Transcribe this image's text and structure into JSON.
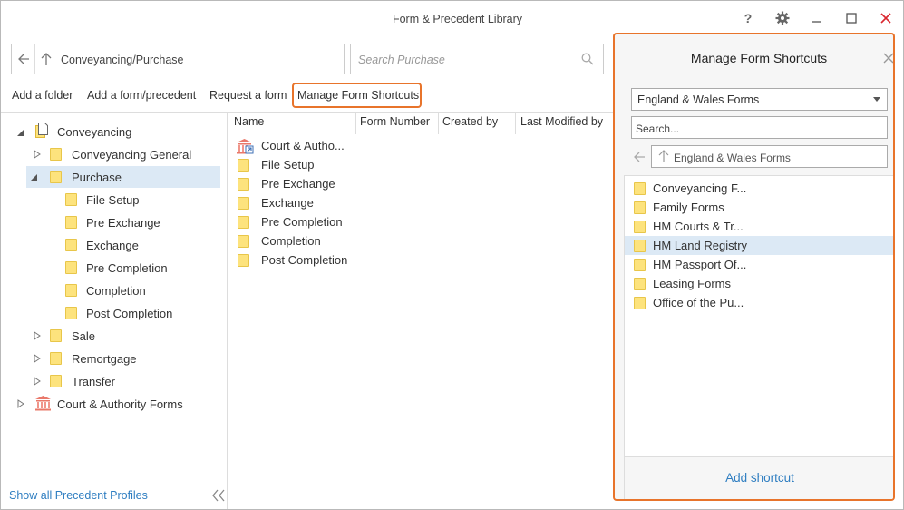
{
  "window": {
    "title": "Form & Precedent Library"
  },
  "address": {
    "path": "Conveyancing/Purchase"
  },
  "search": {
    "placeholder": "Search Purchase"
  },
  "toolbar": {
    "add_folder": "Add a folder",
    "add_form": "Add a form/precedent",
    "request_form": "Request a form",
    "manage_shortcuts": "Manage Form Shortcuts"
  },
  "tree": {
    "root": "Conveyancing",
    "conv_general": "Conveyancing General",
    "purchase": "Purchase",
    "purchase_children": [
      "File Setup",
      "Pre Exchange",
      "Exchange",
      "Pre Completion",
      "Completion",
      "Post Completion"
    ],
    "sale": "Sale",
    "remortgage": "Remortgage",
    "transfer": "Transfer",
    "court": "Court & Authority Forms"
  },
  "footer": {
    "show_profiles": "Show all Precedent Profiles"
  },
  "list": {
    "columns": [
      "Name",
      "Form Number",
      "Created by",
      "Last Modified by"
    ],
    "rows": [
      "Court & Autho...",
      "File Setup",
      "Pre Exchange",
      "Exchange",
      "Pre Completion",
      "Completion",
      "Post Completion"
    ]
  },
  "panel": {
    "title": "Manage Form Shortcuts",
    "dropdown_value": "England & Wales Forms",
    "search_placeholder": "Search...",
    "nav_path": "England & Wales Forms",
    "items": [
      "Conveyancing F...",
      "Family Forms",
      "HM Courts & Tr...",
      "HM Land Registry",
      "HM Passport Of...",
      "Leasing Forms",
      "Office of the Pu..."
    ],
    "add_shortcut": "Add shortcut"
  },
  "colors": {
    "accent": "#e8742b",
    "link": "#2f7ec1",
    "selection": "#dce9f5",
    "folder": "#fde37d",
    "close": "#d9262e"
  }
}
